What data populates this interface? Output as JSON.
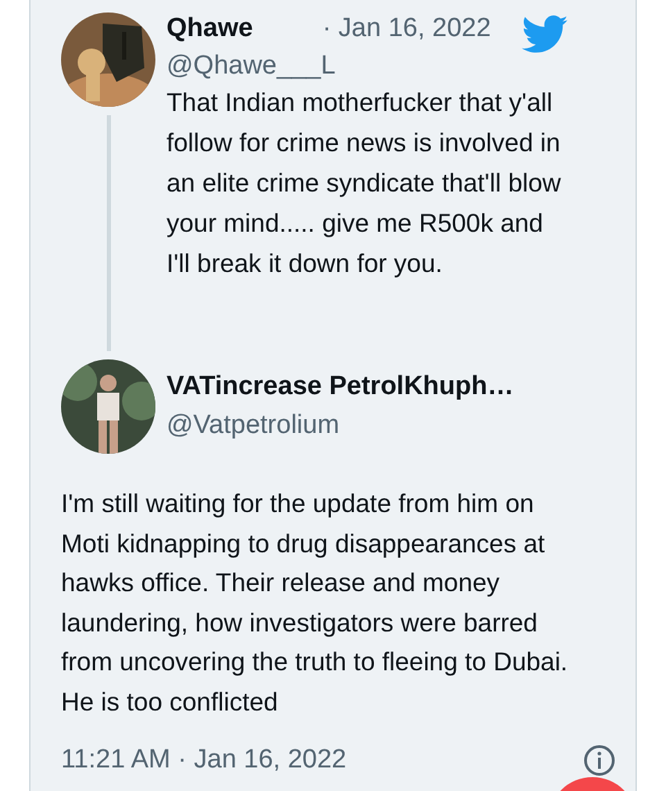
{
  "tweets": [
    {
      "kind": "parent",
      "name": "Qhawe",
      "handle": "@Qhawe___L",
      "date": "· Jan 16, 2022",
      "text": "That Indian motherfucker that y'all follow for crime news is involved in an elite crime syndicate that'll blow your mind..... give me R500k and I'll break it down for you."
    },
    {
      "kind": "main",
      "name": "VATincrease PetrolKhuph…",
      "handle": "@Vatpetrolium",
      "text": "I'm still waiting for the update from him on Moti kidnapping to drug disappearances at hawks office. Their release  and money laundering, how investigators were barred from uncovering the truth to fleeing to Dubai. He is too conflicted",
      "timestamp": "11:21 AM · Jan 16, 2022"
    }
  ]
}
